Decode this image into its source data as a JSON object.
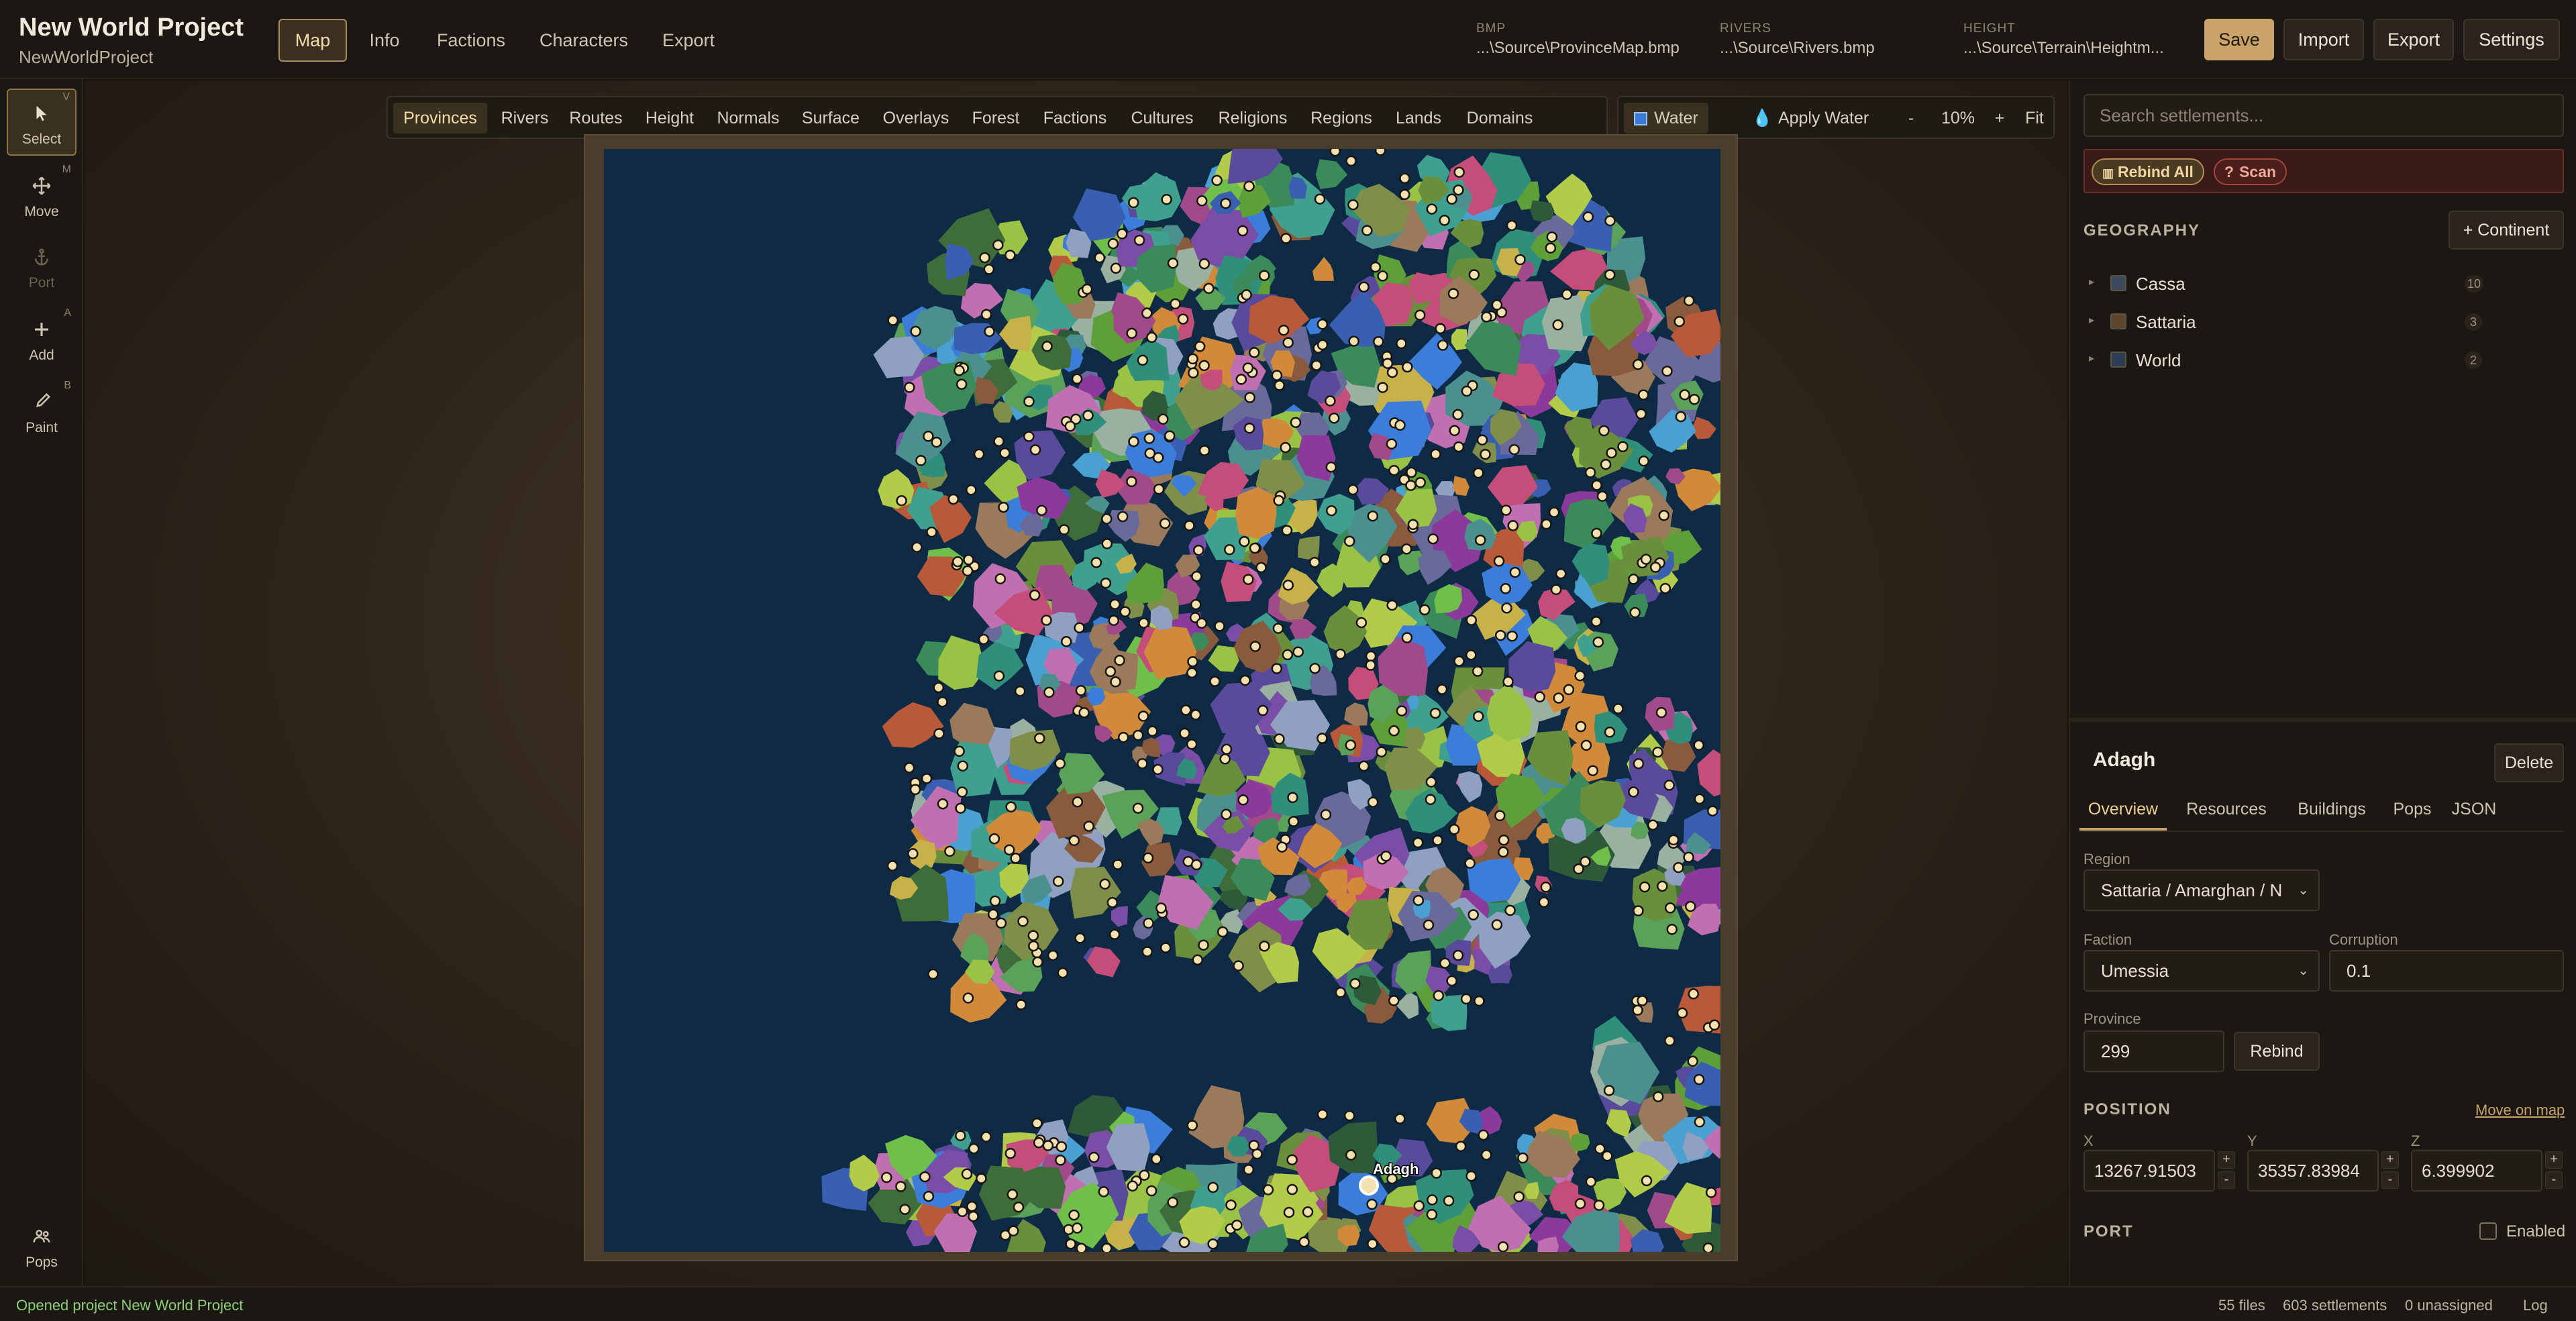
{
  "app": {
    "title": "New World Project",
    "subtitle": "NewWorldProject"
  },
  "nav": {
    "tabs": [
      "Map",
      "Info",
      "Factions",
      "Characters",
      "Export"
    ],
    "active": "Map"
  },
  "paths": {
    "bmp_label": "BMP",
    "bmp_value": "...\\Source\\ProvinceMap.bmp",
    "rivers_label": "RIVERS",
    "rivers_value": "...\\Source\\Rivers.bmp",
    "height_label": "HEIGHT",
    "height_value": "...\\Source\\Terrain\\Heightm..."
  },
  "top_actions": {
    "save": "Save",
    "import": "Import",
    "export": "Export",
    "settings": "Settings"
  },
  "tools": [
    {
      "label": "Select",
      "key": "V",
      "icon": "cursor-icon",
      "active": true
    },
    {
      "label": "Move",
      "key": "M",
      "icon": "move-icon"
    },
    {
      "label": "Port",
      "key": "",
      "icon": "anchor-icon",
      "disabled": true
    },
    {
      "label": "Add",
      "key": "A",
      "icon": "plus-icon"
    },
    {
      "label": "Paint",
      "key": "B",
      "icon": "brush-icon"
    },
    {
      "label": "Pops",
      "key": "",
      "icon": "people-icon"
    }
  ],
  "layers": [
    "Provinces",
    "Rivers",
    "Routes",
    "Height",
    "Normals",
    "Surface",
    "Overlays",
    "Forest",
    "Factions",
    "Cultures",
    "Religions",
    "Regions",
    "Lands",
    "Domains"
  ],
  "active_layer": "Provinces",
  "water_bar": {
    "water": "Water",
    "apply_water": "Apply Water",
    "minus": "-",
    "zoom": "10%",
    "plus": "+",
    "fit": "Fit"
  },
  "map": {
    "selected_label": "Adagh"
  },
  "sidebar": {
    "search_placeholder": "Search settlements...",
    "rebind_all": "Rebind All",
    "scan": "Scan",
    "geography_label": "GEOGRAPHY",
    "add_continent": "+ Continent",
    "continents": [
      {
        "name": "Cassa",
        "count": "10",
        "color": "#3a4a5c"
      },
      {
        "name": "Sattaria",
        "count": "3",
        "color": "#5c4630"
      },
      {
        "name": "World",
        "count": "2",
        "color": "#2e3e52"
      }
    ]
  },
  "detail": {
    "title": "Adagh",
    "delete": "Delete",
    "tabs": [
      "Overview",
      "Resources",
      "Buildings",
      "Pops",
      "JSON"
    ],
    "active_tab": "Overview",
    "region_label": "Region",
    "region_value": "Sattaria / Amarghan / N",
    "faction_label": "Faction",
    "faction_value": "Umessia",
    "corruption_label": "Corruption",
    "corruption_value": "0.1",
    "province_label": "Province",
    "province_value": "299",
    "rebind": "Rebind",
    "position_label": "POSITION",
    "move_on_map": "Move on map",
    "x_label": "X",
    "x_value": "13267.91503",
    "y_label": "Y",
    "y_value": "35357.83984",
    "z_label": "Z",
    "z_value": "6.399902",
    "port_label": "PORT",
    "enabled_label": "Enabled"
  },
  "status": {
    "message": "Opened project New World Project",
    "files": "55 files",
    "settlements": "603 settlements",
    "unassigned": "0 unassigned",
    "log": "Log"
  }
}
